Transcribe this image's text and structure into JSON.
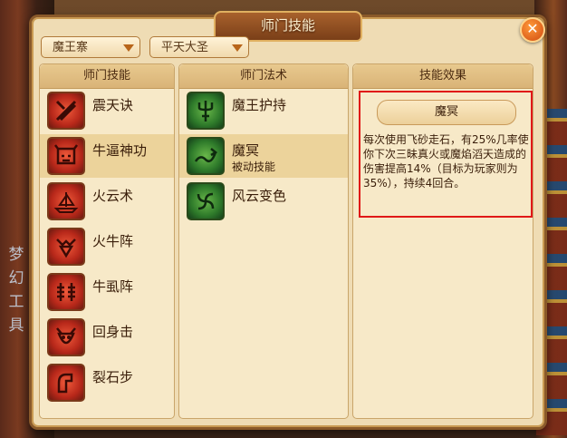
{
  "window": {
    "title": "师门技能",
    "close_glyph": "✕"
  },
  "background": {
    "side_text": "梦幻工具"
  },
  "dropdowns": [
    {
      "value": "魔王寨"
    },
    {
      "value": "平天大圣"
    }
  ],
  "columns": {
    "skills_header": "师门技能",
    "spells_header": "师门法术",
    "effect_header": "技能效果"
  },
  "skills": [
    {
      "label": "震天诀",
      "icon": "crossed-blades-icon"
    },
    {
      "label": "牛逼神功",
      "icon": "bull-mask-icon"
    },
    {
      "label": "火云术",
      "icon": "flame-ship-icon"
    },
    {
      "label": "火牛阵",
      "icon": "bull-formation-icon"
    },
    {
      "label": "牛虱阵",
      "icon": "louse-formation-icon"
    },
    {
      "label": "回身击",
      "icon": "demon-face-icon"
    },
    {
      "label": "裂石步",
      "icon": "stone-step-icon"
    }
  ],
  "selected_skill_index": 1,
  "spells": [
    {
      "label": "魔王护持",
      "sublabel": "",
      "icon": "trident-icon"
    },
    {
      "label": "魔冥",
      "sublabel": "被动技能",
      "icon": "serpent-icon"
    },
    {
      "label": "风云变色",
      "sublabel": "",
      "icon": "whirlwind-icon"
    }
  ],
  "selected_spell_index": 1,
  "effect": {
    "name": "魔冥",
    "description": "每次使用飞砂走石，有25%几率使你下次三昧真火或魔焰滔天造成的伤害提高14%（目标为玩家则为35%），持续4回合。"
  },
  "colors": {
    "panel": "#efdcb4",
    "highlight": "#ecd39b",
    "effect_border": "#e01818",
    "skill_icon": "#c8321e",
    "spell_icon": "#2e7a2a"
  }
}
